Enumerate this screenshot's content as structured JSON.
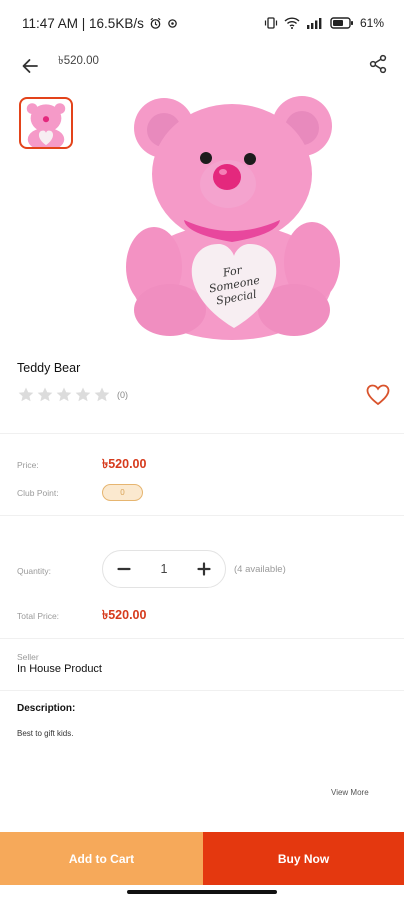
{
  "status_bar": {
    "time_speed": "11:47 AM | 16.5KB/s",
    "battery_percent": "61%",
    "icons": [
      "alarm-icon",
      "signal-dot-icon",
      "vibrate-icon",
      "wifi-icon",
      "cell-signal-icon",
      "battery-icon"
    ]
  },
  "app_bar": {
    "title": "৳520.00",
    "icons": [
      "back-arrow-icon",
      "share-icon"
    ]
  },
  "product": {
    "name": "Teddy Bear",
    "rating_stars_filled": 0,
    "rating_stars_total": 5,
    "rating_count": "(0)",
    "image_alt_text": "For Someone Special",
    "image_colors": {
      "fur": "#f59ac8",
      "fur_shadow": "#e57fb4",
      "nose": "#e4287d",
      "heart": "#f7eef2"
    }
  },
  "details": {
    "price_label": "Price:",
    "price_value": "৳520.00",
    "club_point_label": "Club Point:",
    "club_point_value": "0",
    "quantity_label": "Quantity:",
    "quantity_value": "1",
    "quantity_available": "(4 available)",
    "total_price_label": "Total Price:",
    "total_price_value": "৳520.00",
    "seller_label": "Seller",
    "seller_name": "In House Product",
    "description_heading": "Description:",
    "description_text": "Best to gift kids.",
    "view_more": "View More"
  },
  "actions": {
    "add_to_cart": "Add to Cart",
    "buy_now": "Buy Now"
  },
  "colors": {
    "accent": "#e4380f",
    "add_to_cart_bg": "#f6a95a",
    "price_text": "#d63a1c",
    "wishlist_heart": "#d9532c"
  }
}
